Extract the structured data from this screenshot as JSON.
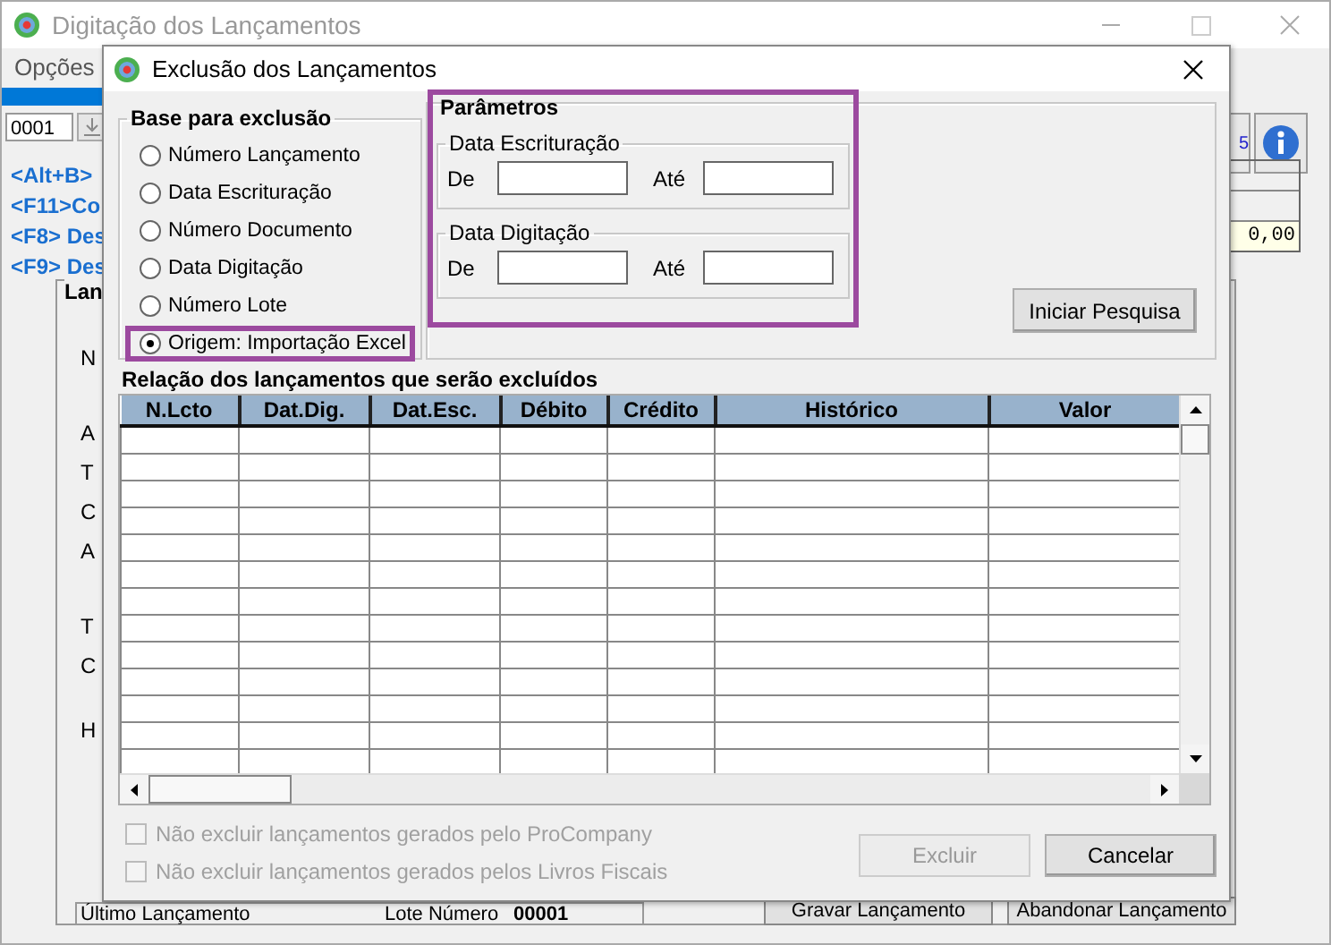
{
  "background_window": {
    "title": "Digitação dos Lançamentos",
    "menu": [
      "Opções"
    ],
    "record_field": "0001",
    "toolbar_fragment": "5",
    "shortcuts": [
      "<Alt+B>",
      "<F11>Co",
      "<F8> Des",
      "<F9> Des"
    ],
    "total": "0,00",
    "panel_label": "Lan",
    "panel_letters": [
      "N",
      "A",
      "T",
      "C",
      "A",
      "T",
      "C",
      "H"
    ],
    "status_bar": {
      "label": "Último Lançamento",
      "lote_label": "Lote Número",
      "lote_value": "00001"
    },
    "buttons": [
      "Gravar Lançamento",
      "Abandonar Lançamento"
    ]
  },
  "dialog": {
    "title": "Exclusão dos Lançamentos",
    "base_group": {
      "title": "Base para exclusão",
      "options": [
        {
          "label": "Número Lançamento",
          "selected": false,
          "highlighted": false
        },
        {
          "label": "Data Escrituração",
          "selected": false,
          "highlighted": false
        },
        {
          "label": "Número Documento",
          "selected": false,
          "highlighted": false
        },
        {
          "label": "Data Digitação",
          "selected": false,
          "highlighted": false
        },
        {
          "label": "Número Lote",
          "selected": false,
          "highlighted": false
        },
        {
          "label": "Origem: Importação Excel",
          "selected": true,
          "highlighted": true
        }
      ]
    },
    "parameters": {
      "title": "Parâmetros",
      "highlighted": true,
      "groups": [
        {
          "title": "Data Escrituração",
          "from_label": "De",
          "to_label": "Até"
        },
        {
          "title": "Data Digitação",
          "from_label": "De",
          "to_label": "Até"
        }
      ]
    },
    "search_button": "Iniciar Pesquisa",
    "list_title": "Relação dos lançamentos que serão excluídos",
    "table": {
      "columns": [
        "N.Lcto",
        "Dat.Dig.",
        "Dat.Esc.",
        "Débito",
        "Crédito",
        "Histórico",
        "Valor"
      ]
    },
    "checkboxes": [
      {
        "label": "Não excluir lançamentos gerados pelo ProCompany",
        "checked": false,
        "disabled": true
      },
      {
        "label": "Não excluir lançamentos gerados pelos Livros Fiscais",
        "checked": false,
        "disabled": true
      }
    ],
    "buttons": [
      {
        "label": "Excluir",
        "disabled": true
      },
      {
        "label": "Cancelar",
        "disabled": false
      }
    ]
  }
}
